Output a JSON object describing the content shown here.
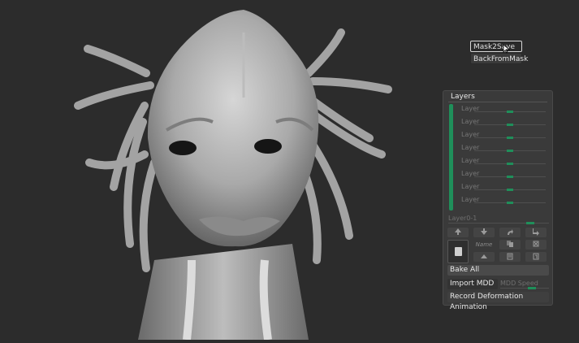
{
  "viewport": {
    "background": "#2c2c2c",
    "model": "alien-head-sculpt"
  },
  "floating_buttons": {
    "mask2save": "Mask2Save",
    "backfrommask": "BackFromMask"
  },
  "layers_panel": {
    "title": "Layers",
    "accent": "#1f8f5a",
    "layers": [
      {
        "label": "Layer"
      },
      {
        "label": "Layer"
      },
      {
        "label": "Layer"
      },
      {
        "label": "Layer"
      },
      {
        "label": "Layer"
      },
      {
        "label": "Layer"
      },
      {
        "label": "Layer"
      },
      {
        "label": "Layer"
      }
    ],
    "active_layer": "Layer0-1",
    "tool_row_1": [
      "arrow-up-icon",
      "arrow-down-icon",
      "redo-icon",
      "exit-icon"
    ],
    "name_label": "Name",
    "tool_row_3": [
      "split-icon",
      "duplicate-icon",
      "merge-icon"
    ],
    "buttons": {
      "bake_all": "Bake All",
      "import_mdd": "Import MDD",
      "mdd_speed": "MDD Speed",
      "record": "Record Deformation Animation"
    }
  }
}
